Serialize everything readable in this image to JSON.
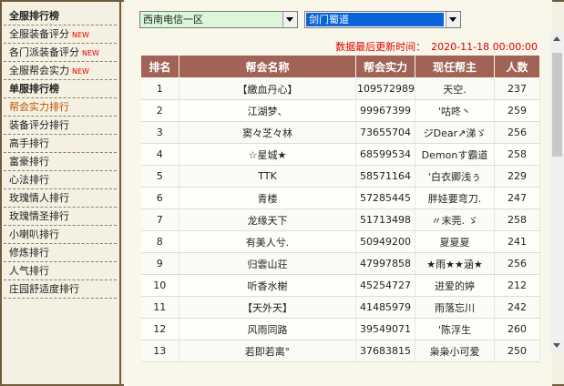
{
  "sidebar": {
    "items": [
      {
        "label": "全服排行榜",
        "kind": "header"
      },
      {
        "label": "全服装备评分",
        "badge": "NEW"
      },
      {
        "label": "各门派装备评分",
        "badge": "NEW"
      },
      {
        "label": "全服帮会实力",
        "badge": "NEW"
      },
      {
        "label": "单服排行榜",
        "kind": "header"
      },
      {
        "label": "帮会实力排行",
        "kind": "active"
      },
      {
        "label": "装备评分排行"
      },
      {
        "label": "高手排行"
      },
      {
        "label": "富豪排行"
      },
      {
        "label": "心法排行"
      },
      {
        "label": "玫瑰情人排行"
      },
      {
        "label": "玫瑰情圣排行"
      },
      {
        "label": "小喇叭排行"
      },
      {
        "label": "修炼排行"
      },
      {
        "label": "人气排行"
      },
      {
        "label": "庄园舒适度排行"
      }
    ]
  },
  "filters": {
    "region": "西南电信一区",
    "server": "剑门蜀道"
  },
  "update": {
    "label": "数据最后更新时间：",
    "time": "2020-11-18 00:00:00"
  },
  "table": {
    "headers": [
      "排名",
      "帮会名称",
      "帮会实力",
      "现任帮主",
      "人数"
    ],
    "rows": [
      [
        "1",
        "【繳血丹心】",
        "109572989",
        "天空.",
        "237"
      ],
      [
        "2",
        "江湖梦、",
        "99967399",
        "'咕咚丶",
        "259"
      ],
      [
        "3",
        "窦々芝々林",
        "73655704",
        "ジDear↗涕ゞ",
        "256"
      ],
      [
        "4",
        "☆星城★",
        "68599534",
        "Demonす霸道",
        "258"
      ],
      [
        "5",
        "TTK",
        "58571164",
        "'白衣卿浅ぅ",
        "229"
      ],
      [
        "6",
        "青楼",
        "57285445",
        "胖娃要弯刀.",
        "247"
      ],
      [
        "7",
        "龙缘天下",
        "51713498",
        "〃末莞. ゞ",
        "258"
      ],
      [
        "8",
        "有美人兮.",
        "50949200",
        "夏夏夏",
        "241"
      ],
      [
        "9",
        "归雲山荘",
        "47997858",
        "★雨★★涵★",
        "256"
      ],
      [
        "10",
        "听香水榭",
        "45254727",
        "进爱的婷",
        "212"
      ],
      [
        "11",
        "【天外天】",
        "41485979",
        "雨落忘川",
        "242"
      ],
      [
        "12",
        "风雨同路",
        "39549071",
        "'陈浮生",
        "260"
      ],
      [
        "13",
        "若即若离°",
        "37683815",
        "枭枭小可爱",
        "250"
      ]
    ]
  }
}
